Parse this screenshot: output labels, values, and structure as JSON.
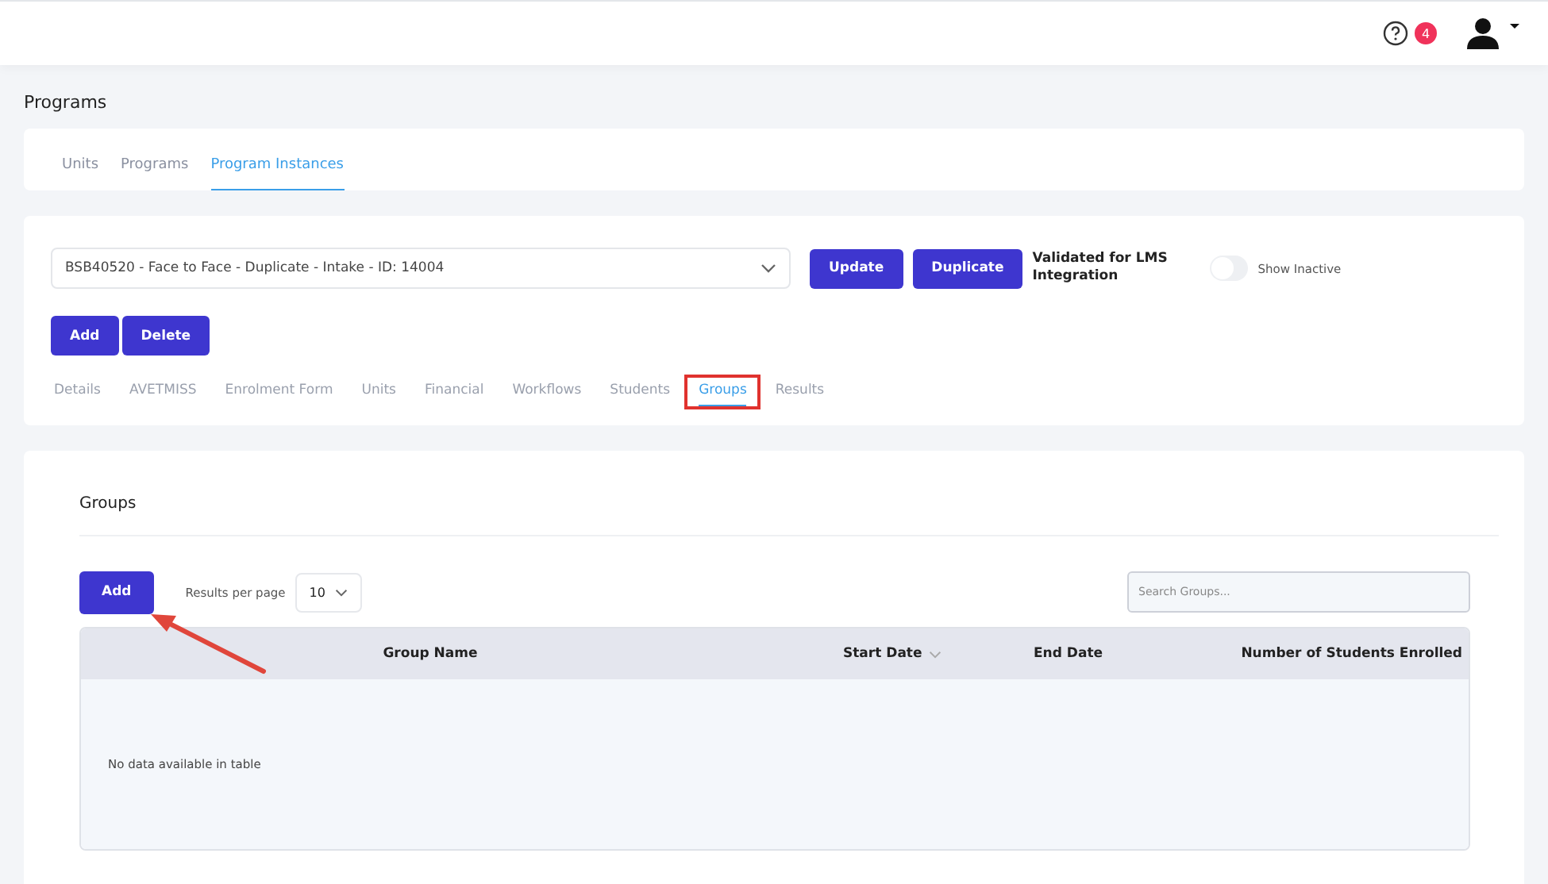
{
  "topbar": {
    "notifications": "4"
  },
  "page_title": "Programs",
  "tabs": [
    {
      "label": "Units",
      "selected": false
    },
    {
      "label": "Programs",
      "selected": false
    },
    {
      "label": "Program Instances",
      "selected": true
    }
  ],
  "instance": {
    "select_value": "BSB40520 - Face to Face - Duplicate - Intake - ID: 14004",
    "buttons": [
      "Update",
      "Duplicate"
    ],
    "validated_label": "Validated for LMS Integration",
    "show_inactive": {
      "label": "Show Inactive",
      "on": false
    },
    "actions": [
      "Add",
      "Delete"
    ]
  },
  "subtabs": [
    {
      "label": "Details",
      "selected": false,
      "highlighted": false
    },
    {
      "label": "AVETMISS",
      "selected": false,
      "highlighted": false
    },
    {
      "label": "Enrolment Form",
      "selected": false,
      "highlighted": false
    },
    {
      "label": "Units",
      "selected": false,
      "highlighted": false
    },
    {
      "label": "Financial",
      "selected": false,
      "highlighted": false
    },
    {
      "label": "Workflows",
      "selected": false,
      "highlighted": false
    },
    {
      "label": "Students",
      "selected": false,
      "highlighted": false
    },
    {
      "label": "Groups",
      "selected": true,
      "highlighted": true
    },
    {
      "label": "Results",
      "selected": false,
      "highlighted": false
    }
  ],
  "groups": {
    "title": "Groups",
    "add_button": {
      "label": "Add",
      "pointed_at": true
    },
    "results_per_page_label": "Results per page",
    "results_per_page": "10",
    "search": {
      "placeholder": "Search Groups..."
    },
    "table": {
      "columns": [
        {
          "label": "Group Name",
          "sortable": false
        },
        {
          "label": "Start Date",
          "sortable": true
        },
        {
          "label": "End Date",
          "sortable": false
        },
        {
          "label": "Number of Students Enrolled",
          "sortable": false
        }
      ],
      "empty_message": "No data available in table"
    }
  }
}
